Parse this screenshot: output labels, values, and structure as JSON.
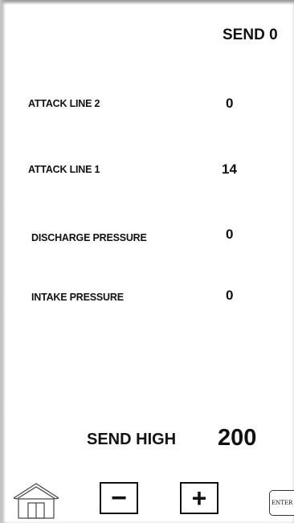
{
  "header": {
    "send_status": "SEND 0"
  },
  "readings": [
    {
      "label": "ATTACK LINE 2",
      "value": "0"
    },
    {
      "label": "ATTACK LINE 1",
      "value": "14"
    },
    {
      "label": "DISCHARGE PRESSURE",
      "value": "0"
    },
    {
      "label": "INTAKE PRESSURE",
      "value": "0"
    }
  ],
  "send_high": {
    "label": "SEND HIGH",
    "value": "200"
  },
  "controls": {
    "home_icon": "home-icon",
    "minus_label": "−",
    "plus_label": "+",
    "enter_label": "ENTER"
  },
  "colors": {
    "background": "#ffffff",
    "text": "#111111"
  }
}
